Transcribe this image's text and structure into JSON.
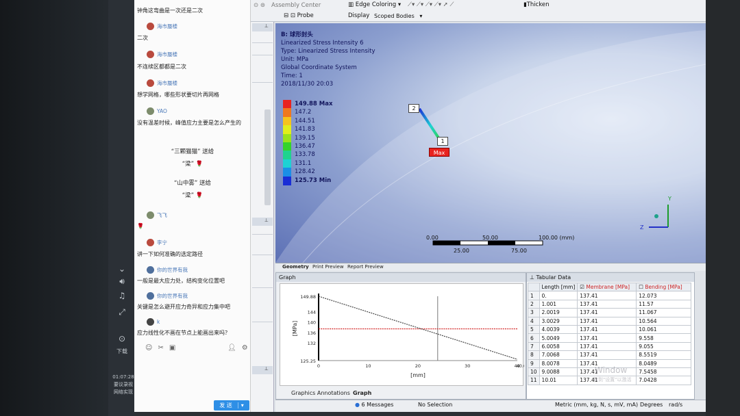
{
  "chat": {
    "top_line": "钟角这弯曲是一次还是二次",
    "messages": [
      {
        "name": "海市蜃楼",
        "text": "二次"
      },
      {
        "name": "海市蜃楼",
        "text": "不连续区都都是二次"
      },
      {
        "name": "海市蜃楼",
        "text": "想学网格，哪些形状要切片再网格"
      },
      {
        "name": "YAO",
        "text": "没有温差时候，峰值应力主要是怎么产生的"
      },
      {
        "name": "飞飞",
        "text": ""
      },
      {
        "name": "李宁",
        "text": "讲一下如何准确的选定路径"
      },
      {
        "name": "你的世界有我",
        "text": "一般是最大应力处，结构变化位置吧"
      },
      {
        "name": "你的世界有我",
        "text": "关键是怎么避开应力奇异和应力集中吧"
      },
      {
        "name": "k",
        "text": "应力线性化不画在节点上能画出来吗？"
      }
    ],
    "gifts": [
      {
        "from": "“三颗猫猫” 送给",
        "to": "“梁”"
      },
      {
        "from": "“山中雾” 送给",
        "to": "“梁”"
      }
    ],
    "flower": "🌹",
    "send_label": "发 送",
    "send_arrow": "▾"
  },
  "taskbar": {
    "download_label": "下载",
    "clock": "01:07:28",
    "clock_sub1": "要议录视",
    "clock_sub2": "网络实现"
  },
  "toolbar": {
    "assembly_center": "Assembly Center",
    "edge_coloring": "Edge Coloring",
    "thicken": "Thicken",
    "probe": "Probe",
    "display": "Display",
    "scoped_bodies": "Scoped Bodies"
  },
  "viewport": {
    "info": [
      "B: 球形封头",
      "Linearized Stress Intensity 6",
      "Type: Linearized Stress Intensity",
      "Unit: MPa",
      "Global Coordinate System",
      "Time: 1",
      "2018/11/30 20:03"
    ],
    "legend": [
      {
        "label": "149.88 Max",
        "color": "#e8231f"
      },
      {
        "label": "147.2",
        "color": "#f0781e"
      },
      {
        "label": "144.51",
        "color": "#f6c31d"
      },
      {
        "label": "141.83",
        "color": "#e1ee1c"
      },
      {
        "label": "139.15",
        "color": "#9ae21c"
      },
      {
        "label": "136.47",
        "color": "#35d32a"
      },
      {
        "label": "133.78",
        "color": "#1fd38e"
      },
      {
        "label": "131.1",
        "color": "#1ed2d4"
      },
      {
        "label": "128.42",
        "color": "#1b8fe6"
      },
      {
        "label": "125.73 Min",
        "color": "#1a2ed6"
      }
    ],
    "probe_label_1": "1",
    "probe_label_2": "2",
    "max_label": "Max",
    "scale_top": [
      "0.00",
      "50.00",
      "100.00 (mm)"
    ],
    "scale_bottom": [
      "25.00",
      "75.00"
    ],
    "triad": {
      "y": "Y",
      "z": "Z"
    }
  },
  "tabs": {
    "geometry": "Geometry",
    "print_preview": "Print Preview",
    "report_preview": "Report Preview"
  },
  "graph": {
    "title": "Graph",
    "ylabel": "[MPa]",
    "xlabel": "[mm]",
    "bottom_tabs": [
      "Graphics Annotations",
      "Graph"
    ]
  },
  "chart_data": {
    "type": "line",
    "xlabel": "[mm]",
    "ylabel": "[MPa]",
    "ylim": [
      125.25,
      149.88
    ],
    "xlim": [
      0,
      40.047
    ],
    "y_ticks": [
      "149.88",
      "144",
      "140",
      "136",
      "132",
      "125.25"
    ],
    "x_ticks": [
      "0",
      "10",
      "20",
      "30",
      "40",
      "40.047"
    ],
    "series": [
      {
        "name": "Membrane",
        "color": "#d42a2a",
        "x": [
          0,
          40.047
        ],
        "values": [
          137.41,
          137.41
        ]
      },
      {
        "name": "Bending",
        "color": "#444444",
        "x": [
          0,
          40.047
        ],
        "values": [
          149.88,
          125.73
        ]
      }
    ]
  },
  "tabular": {
    "title": "Tabular Data",
    "headers": [
      "Length [mm]",
      "Membrane [MPa]",
      "Bending [MPa]"
    ],
    "rows": [
      [
        "1",
        "0.",
        "137.41",
        "12.073"
      ],
      [
        "2",
        "1.001",
        "137.41",
        "11.57"
      ],
      [
        "3",
        "2.0019",
        "137.41",
        "11.067"
      ],
      [
        "4",
        "3.0029",
        "137.41",
        "10.564"
      ],
      [
        "5",
        "4.0039",
        "137.41",
        "10.061"
      ],
      [
        "6",
        "5.0049",
        "137.41",
        "9.558"
      ],
      [
        "7",
        "6.0058",
        "137.41",
        "9.055"
      ],
      [
        "8",
        "7.0068",
        "137.41",
        "8.5519"
      ],
      [
        "9",
        "8.0078",
        "137.41",
        "8.0489"
      ],
      [
        "10",
        "9.0088",
        "137.41",
        "7.5458"
      ],
      [
        "11",
        "10.01",
        "137.41",
        "7.0428"
      ]
    ]
  },
  "status": {
    "messages": "6 Messages",
    "selection": "No Selection",
    "units": "Metric (mm, kg, N, s, mV, mA)",
    "degrees": "Degrees",
    "rads": "rad/s"
  },
  "watermark": {
    "line1": "Window",
    "line2": "转到\"设置\"以激活"
  }
}
